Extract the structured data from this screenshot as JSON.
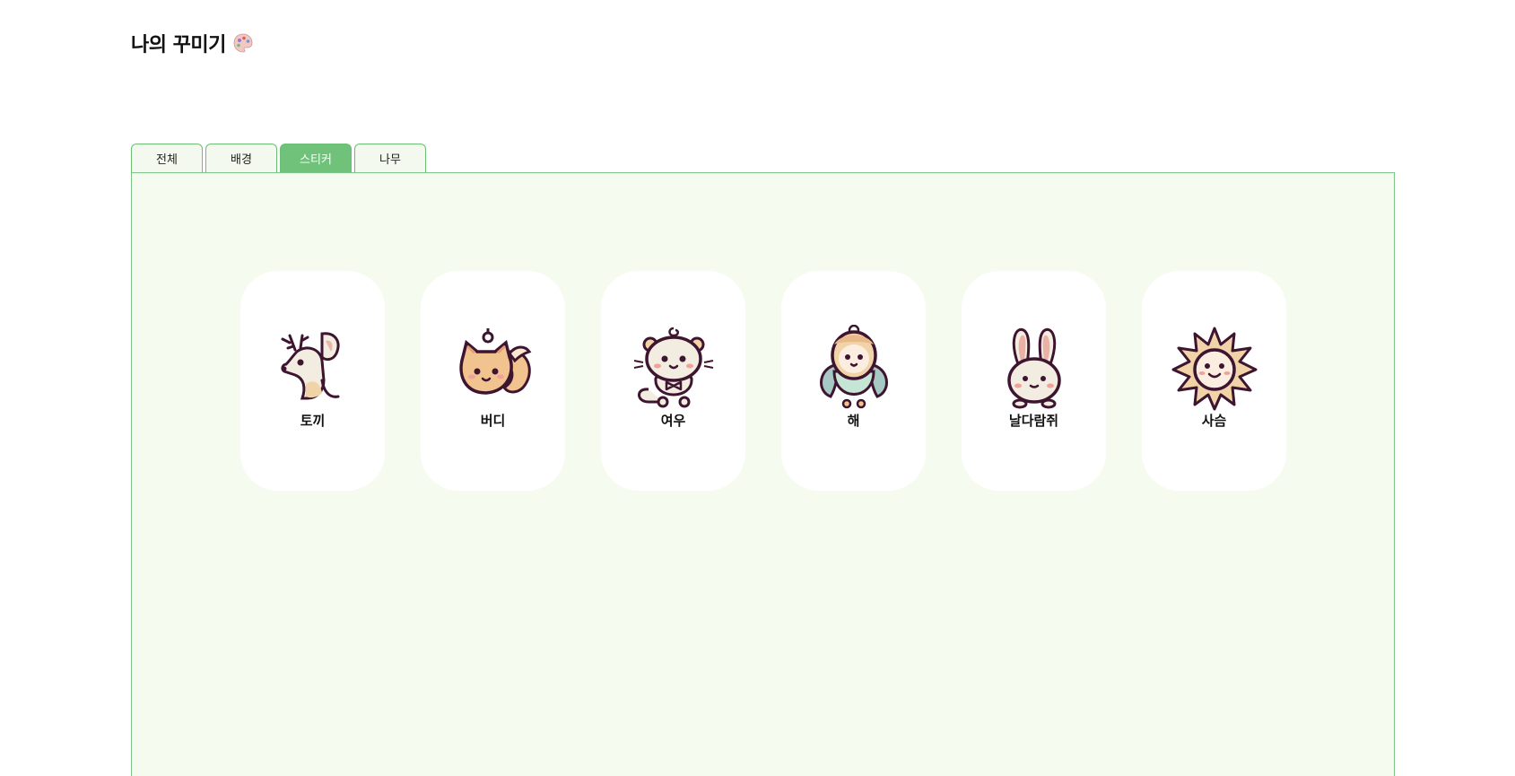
{
  "header": {
    "title": "나의 꾸미기"
  },
  "tabs": [
    {
      "label": "전체",
      "active": false
    },
    {
      "label": "배경",
      "active": false
    },
    {
      "label": "스티커",
      "active": true
    },
    {
      "label": "나무",
      "active": false
    }
  ],
  "stickers": [
    {
      "label": "토끼",
      "icon": "deer-icon"
    },
    {
      "label": "버디",
      "icon": "fox-icon"
    },
    {
      "label": "여우",
      "icon": "cat-icon"
    },
    {
      "label": "해",
      "icon": "bird-icon"
    },
    {
      "label": "날다람쥐",
      "icon": "rabbit-icon"
    },
    {
      "label": "사슴",
      "icon": "sun-icon"
    }
  ],
  "colors": {
    "accent": "#70c27b",
    "panel_bg": "#f6fbf0",
    "panel_border": "#7cc487",
    "outline": "#3d1530"
  }
}
